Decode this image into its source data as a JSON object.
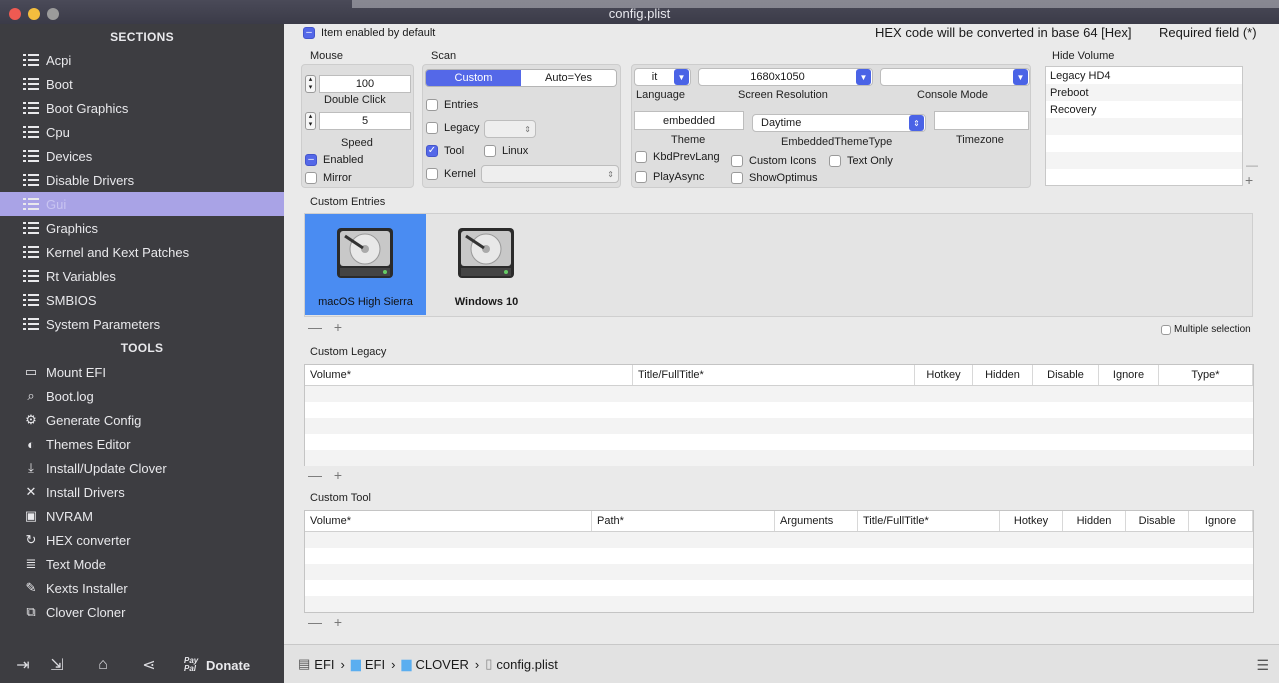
{
  "window": {
    "title": "config.plist"
  },
  "sidebar": {
    "sections_header": "SECTIONS",
    "sections": [
      {
        "label": "Acpi",
        "icon": "list-icon"
      },
      {
        "label": "Boot",
        "icon": "list-icon"
      },
      {
        "label": "Boot Graphics",
        "icon": "list-icon"
      },
      {
        "label": "Cpu",
        "icon": "list-icon"
      },
      {
        "label": "Devices",
        "icon": "list-icon"
      },
      {
        "label": "Disable Drivers",
        "icon": "list-icon"
      },
      {
        "label": "Gui",
        "icon": "list-icon",
        "active": true
      },
      {
        "label": "Graphics",
        "icon": "list-icon"
      },
      {
        "label": "Kernel and Kext Patches",
        "icon": "list-icon"
      },
      {
        "label": "Rt Variables",
        "icon": "list-icon"
      },
      {
        "label": "SMBIOS",
        "icon": "list-icon"
      },
      {
        "label": "System Parameters",
        "icon": "list-icon"
      }
    ],
    "tools_header": "TOOLS",
    "tools": [
      {
        "label": "Mount EFI",
        "icon": "drive-icon",
        "glyph": "▭"
      },
      {
        "label": "Boot.log",
        "icon": "magnifier-icon",
        "glyph": "⌕"
      },
      {
        "label": "Generate Config",
        "icon": "gears-icon",
        "glyph": "⚙"
      },
      {
        "label": "Themes Editor",
        "icon": "palette-icon",
        "glyph": "◐"
      },
      {
        "label": "Install/Update Clover",
        "icon": "download-icon",
        "glyph": "⤓"
      },
      {
        "label": "Install Drivers",
        "icon": "tools-icon",
        "glyph": "✕"
      },
      {
        "label": "NVRAM",
        "icon": "chip-icon",
        "glyph": "▣"
      },
      {
        "label": "HEX converter",
        "icon": "refresh-icon",
        "glyph": "↻"
      },
      {
        "label": "Text Mode",
        "icon": "text-icon",
        "glyph": "≣"
      },
      {
        "label": "Kexts Installer",
        "icon": "puzzle-icon",
        "glyph": "✎"
      },
      {
        "label": "Clover Cloner",
        "icon": "copy-icon",
        "glyph": "⧉"
      }
    ],
    "footer": {
      "donate_prefix": "Pay Pal",
      "donate_label": "Donate"
    }
  },
  "main": {
    "item_enabled_label": "Item enabled by default",
    "hex_note": "HEX code will be converted in base 64 [Hex]",
    "required_note": "Required field (*)",
    "mouse": {
      "title": "Mouse",
      "double_click_value": "100",
      "double_click_label": "Double Click",
      "speed_value": "5",
      "speed_label": "Speed",
      "enabled_label": "Enabled",
      "mirror_label": "Mirror"
    },
    "scan": {
      "title": "Scan",
      "seg_custom": "Custom",
      "seg_auto": "Auto=Yes",
      "entries_label": "Entries",
      "legacy_label": "Legacy",
      "tool_label": "Tool",
      "linux_label": "Linux",
      "kernel_label": "Kernel"
    },
    "language": {
      "value": "it",
      "label": "Language"
    },
    "screen_resolution": {
      "value": "1680x1050",
      "label": "Screen Resolution"
    },
    "console_mode": {
      "value": "",
      "label": "Console Mode"
    },
    "theme": {
      "value": "embedded",
      "label": "Theme"
    },
    "embedded_theme_type": {
      "value": "Daytime",
      "label": "EmbeddedThemeType"
    },
    "timezone": {
      "value": "",
      "label": "Timezone"
    },
    "options": {
      "kbd_prev_lang": "KbdPrevLang",
      "custom_icons": "Custom Icons",
      "text_only": "Text Only",
      "play_async": "PlayAsync",
      "show_optimus": "ShowOptimus"
    },
    "hide_volume": {
      "title": "Hide Volume",
      "items": [
        "Legacy HD4",
        "Preboot",
        "Recovery"
      ]
    },
    "custom_entries": {
      "title": "Custom Entries",
      "items": [
        {
          "label": "macOS High Sierra",
          "selected": true
        },
        {
          "label": "Windows 10",
          "selected": false
        }
      ],
      "multiple_selection": "Multiple selection"
    },
    "custom_legacy": {
      "title": "Custom Legacy",
      "columns": [
        "Volume*",
        "Title/FullTitle*",
        "Hotkey",
        "Hidden",
        "Disable",
        "Ignore",
        "Type*"
      ]
    },
    "custom_tool": {
      "title": "Custom Tool",
      "columns": [
        "Volume*",
        "Path*",
        "Arguments",
        "Title/FullTitle*",
        "Hotkey",
        "Hidden",
        "Disable",
        "Ignore"
      ]
    },
    "plus_minus": "— +"
  },
  "pathbar": {
    "crumbs": [
      {
        "label": "EFI",
        "icon": "disk-icon"
      },
      {
        "label": "EFI",
        "icon": "folder-icon"
      },
      {
        "label": "CLOVER",
        "icon": "folder-icon"
      },
      {
        "label": "config.plist",
        "icon": "file-icon"
      }
    ],
    "separator": "›"
  },
  "colors": {
    "accent": "#5468e8",
    "sidebar_bg": "#3d3d41",
    "active_item": "#a9a3e6",
    "selection_tile": "#4a8cf2"
  }
}
